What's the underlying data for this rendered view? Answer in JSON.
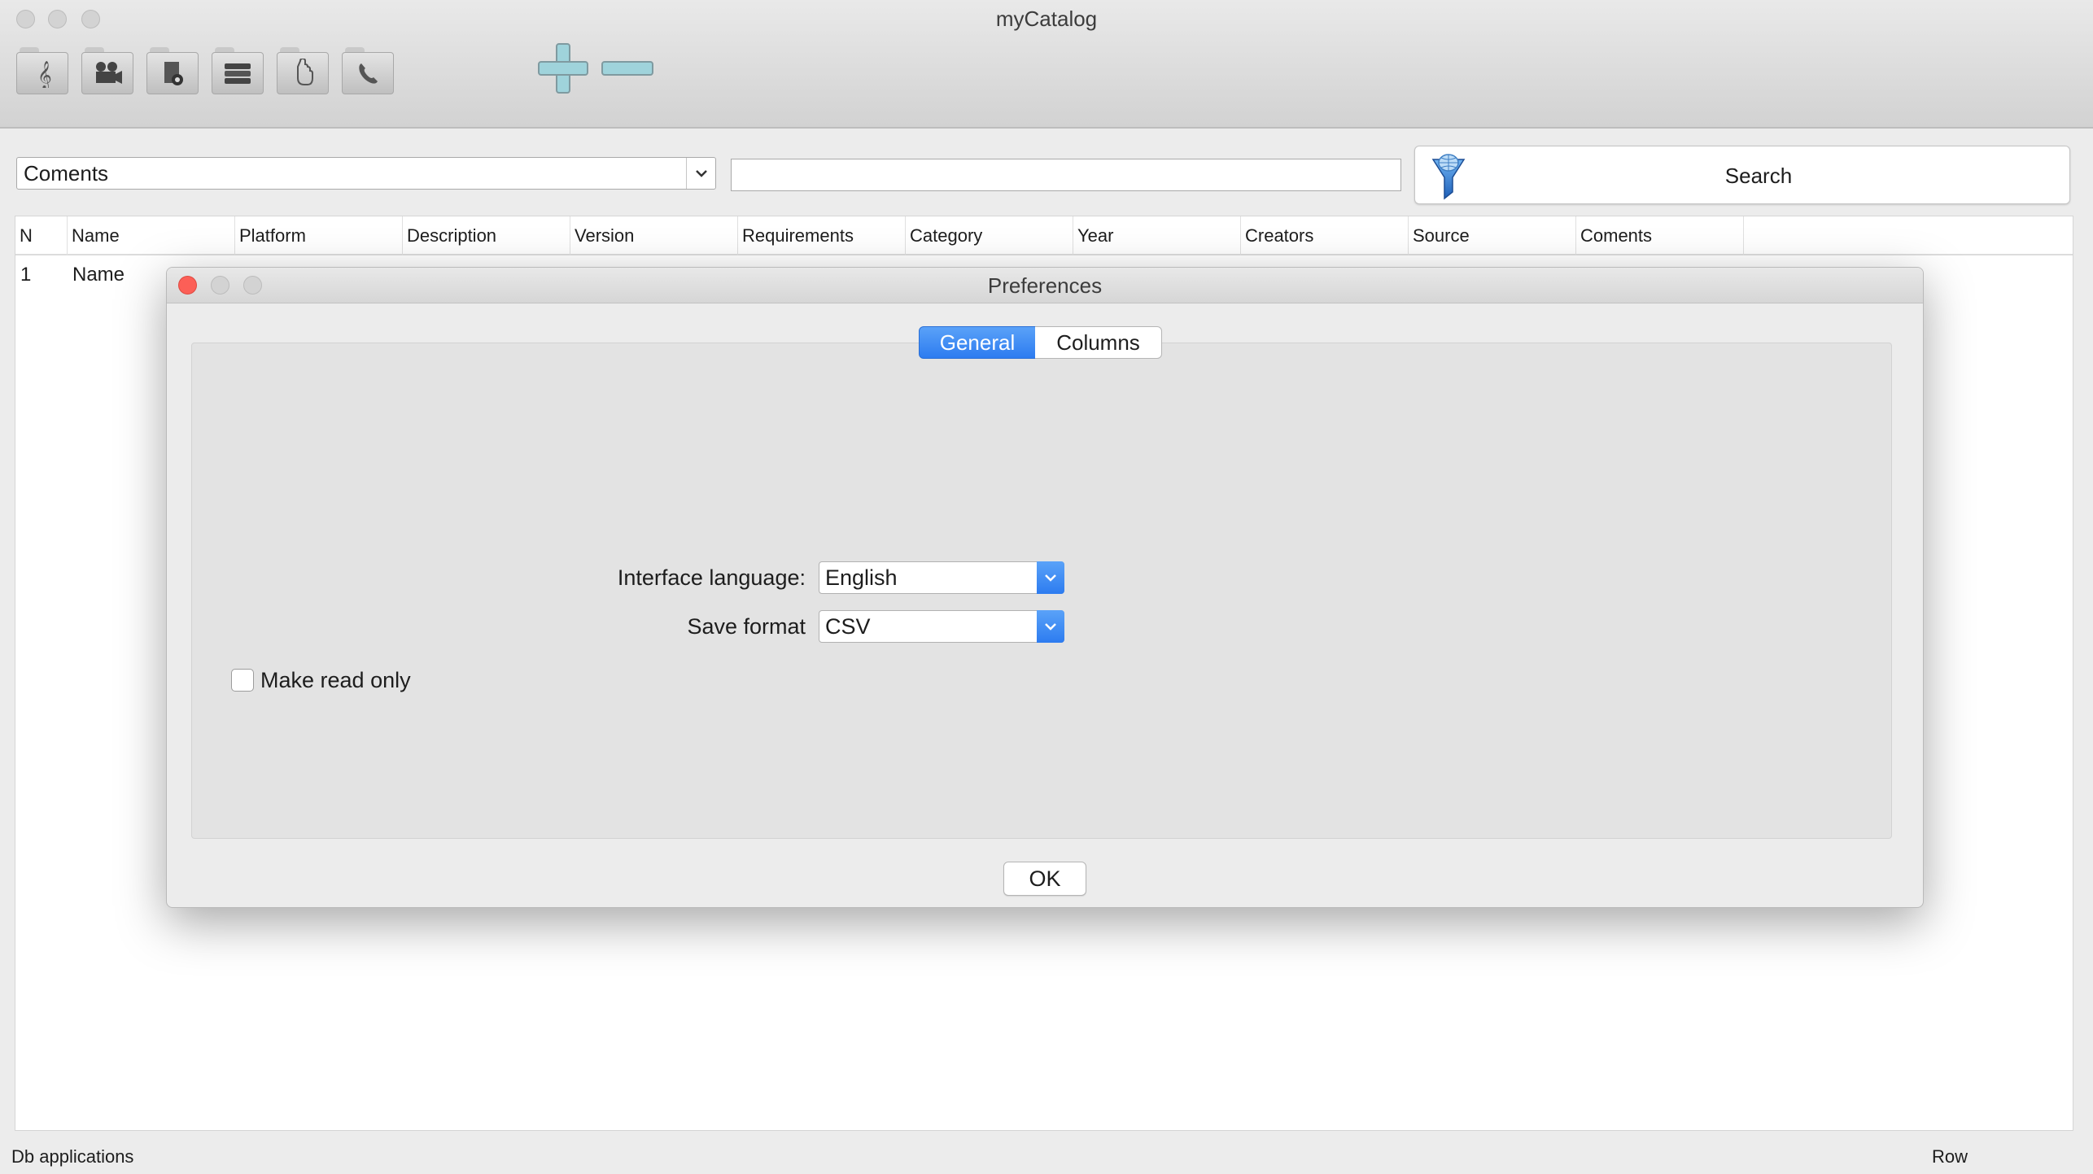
{
  "window": {
    "title": "myCatalog"
  },
  "toolbar": {
    "icons": [
      "music-folder-icon",
      "video-folder-icon",
      "document-folder-icon",
      "books-folder-icon",
      "hand-folder-icon",
      "phone-folder-icon"
    ],
    "add_icon": "plus-icon",
    "remove_icon": "minus-icon"
  },
  "search": {
    "field_selected": "Coments",
    "query": "",
    "button_label": "Search",
    "button_icon": "funnel-globe-icon"
  },
  "table": {
    "columns": [
      "N",
      "Name",
      "Platform",
      "Description",
      "Version",
      "Requirements",
      "Category",
      "Year",
      "Creators",
      "Source",
      "Coments"
    ],
    "rows": [
      {
        "n": "1",
        "name": "Name"
      }
    ]
  },
  "status": {
    "left": "Db applications",
    "right": "Row"
  },
  "preferences": {
    "title": "Preferences",
    "tabs": [
      "General",
      "Columns"
    ],
    "active_tab": "General",
    "read_only_label": "Make read only",
    "read_only_checked": false,
    "language_label": "Interface language:",
    "language_value": "English",
    "format_label": "Save format",
    "format_value": "CSV",
    "ok_label": "OK"
  },
  "colors": {
    "accent": "#2d7cf0",
    "close": "#fc5f57"
  }
}
